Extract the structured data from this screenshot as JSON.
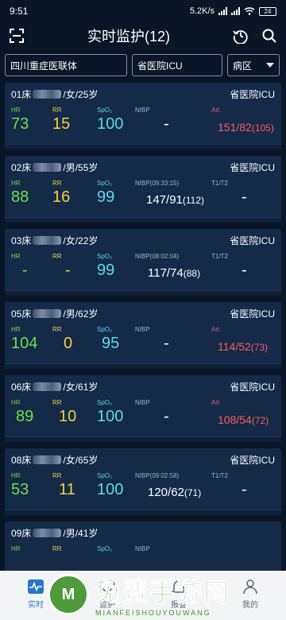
{
  "status_bar": {
    "time": "9:51",
    "net_speed": "5.2K/s",
    "battery": "24"
  },
  "header": {
    "title": "实时监护(12)"
  },
  "filters": {
    "group": "四川重症医联体",
    "hospital": "省医院ICU",
    "area": "病区"
  },
  "labels": {
    "hr": "HR",
    "rr": "RR",
    "spo2": "SpO₂",
    "nibp": "NIBP",
    "art": "Art",
    "t1t2": "T1/T2"
  },
  "patients": [
    {
      "bed": "01床",
      "info": "/女/25岁",
      "ward": "省医院ICU",
      "hr": "73",
      "rr": "15",
      "spo2": "100",
      "nibp_label": "NIBP",
      "nibp": "-",
      "nibp_mean": "",
      "right_label": "Art",
      "right_value": "151/82",
      "right_mean": "(105)"
    },
    {
      "bed": "02床",
      "info": "/男/55岁",
      "ward": "省医院ICU",
      "hr": "88",
      "rr": "16",
      "spo2": "99",
      "nibp_label": "NIBP(09:33:15)",
      "nibp": "147/91",
      "nibp_mean": "(112)",
      "right_label": "T1/T2",
      "right_value": "-",
      "right_mean": ""
    },
    {
      "bed": "03床",
      "info": "/女/22岁",
      "ward": "省医院ICU",
      "hr": "-",
      "rr": "-",
      "spo2": "99",
      "nibp_label": "NIBP(08:02:04)",
      "nibp": "117/74",
      "nibp_mean": "(88)",
      "right_label": "T1/T2",
      "right_value": "-",
      "right_mean": ""
    },
    {
      "bed": "05床",
      "info": "/男/62岁",
      "ward": "省医院ICU",
      "hr": "104",
      "rr": "0",
      "spo2": "95",
      "nibp_label": "NIBP",
      "nibp": "-",
      "nibp_mean": "",
      "right_label": "Art",
      "right_value": "114/52",
      "right_mean": "(73)"
    },
    {
      "bed": "06床",
      "info": "/女/61岁",
      "ward": "省医院ICU",
      "hr": "89",
      "rr": "10",
      "spo2": "100",
      "nibp_label": "NIBP",
      "nibp": "-",
      "nibp_mean": "",
      "right_label": "Art",
      "right_value": "108/54",
      "right_mean": "(72)"
    },
    {
      "bed": "08床",
      "info": "/女/65岁",
      "ward": "省医院ICU",
      "hr": "53",
      "rr": "11",
      "spo2": "100",
      "nibp_label": "NIBP(09:02:58)",
      "nibp": "120/62",
      "nibp_mean": "(71)",
      "right_label": "T1/T2",
      "right_value": "-",
      "right_mean": ""
    },
    {
      "bed": "09床",
      "info": "/男/41岁",
      "ward": "",
      "hr": "",
      "rr": "",
      "spo2": "",
      "nibp_label": "NIBP",
      "nibp": "",
      "nibp_mean": "",
      "right_label": "",
      "right_value": "",
      "right_mean": ""
    }
  ],
  "tabs": [
    {
      "label": "实时",
      "icon": "monitor-icon",
      "active": true
    },
    {
      "label": "监护",
      "icon": "heart-icon",
      "active": false
    },
    {
      "label": "报警",
      "icon": "bell-icon",
      "active": false
    },
    {
      "label": "我的",
      "icon": "user-icon",
      "active": false
    }
  ],
  "watermark": {
    "logo": "M",
    "title": "免费手游网",
    "subtitle": "MIANFEISHOUYOUWANG"
  },
  "colors": {
    "background": "#0a1526",
    "card": "#142a48",
    "hr": "#6be04d",
    "rr": "#f2d13f",
    "spo2": "#5ed8ef",
    "art": "#ff5b62",
    "tab_active": "#2a76c8"
  }
}
